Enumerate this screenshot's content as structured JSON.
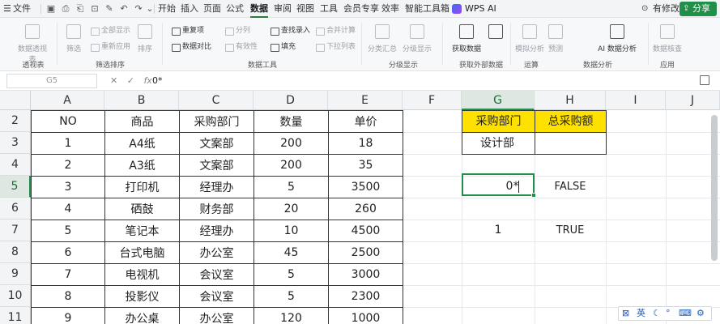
{
  "menubar": {
    "file_menu": "文件",
    "tabs": [
      "开始",
      "插入",
      "页面",
      "公式",
      "数据",
      "审阅",
      "视图",
      "工具",
      "会员专享",
      "效率",
      "智能工具箱"
    ],
    "active_tab": "数据",
    "wps_ai": "WPS AI",
    "review_label": "有修改",
    "share_label": "分享"
  },
  "ribbon": {
    "pivot_table": "数据透视表",
    "filter": "筛选",
    "show_all": "全部显示",
    "reapply": "重新应用",
    "sort": "排序",
    "duplicates": "重复项",
    "compare": "数据对比",
    "split": "分列",
    "validity": "有效性",
    "lookup_entry": "查找录入",
    "fill": "填充",
    "consolidate": "合并计算",
    "dropdown_list": "下拉列表",
    "subtotal": "分类汇总",
    "group_show": "分级显示",
    "get_data": "获取数据",
    "simulate": "模拟分析",
    "forecast": "预测",
    "group_label": "数据分析",
    "ai_data_analysis": "AI 数据分析",
    "data_check": "数据核查",
    "groups": {
      "pivot": "透视表",
      "filter_sort": "筛选排序",
      "data_tools": "数据工具",
      "outline": "分级显示",
      "external": "获取外部数据",
      "calc": "运算",
      "analysis": "数据分析",
      "apply": "应用"
    }
  },
  "formula_bar": {
    "name_box": "G5",
    "cancel_icon": "✕",
    "confirm_icon": "✓",
    "fx_label": "fx",
    "content": "0*"
  },
  "sheet": {
    "columns": [
      "A",
      "B",
      "C",
      "D",
      "E",
      "F",
      "G",
      "H",
      "I",
      "J"
    ],
    "rows": [
      "2",
      "3",
      "4",
      "5",
      "6",
      "7",
      "8",
      "9",
      "10",
      "11"
    ],
    "table_header": [
      "NO",
      "商品",
      "采购部门",
      "数量",
      "单价"
    ],
    "table_rows": [
      [
        "1",
        "A4纸",
        "文案部",
        "200",
        "18"
      ],
      [
        "2",
        "A3纸",
        "文案部",
        "200",
        "35"
      ],
      [
        "3",
        "打印机",
        "经理办",
        "5",
        "3500"
      ],
      [
        "4",
        "硒鼓",
        "财务部",
        "20",
        "260"
      ],
      [
        "5",
        "笔记本",
        "经理办",
        "10",
        "4500"
      ],
      [
        "6",
        "台式电脑",
        "办公室",
        "45",
        "2500"
      ],
      [
        "7",
        "电视机",
        "会议室",
        "5",
        "3000"
      ],
      [
        "8",
        "投影仪",
        "会议室",
        "5",
        "2300"
      ],
      [
        "9",
        "办公桌",
        "办公室",
        "120",
        "1000"
      ]
    ],
    "criteria_header": [
      "采购部门",
      "总采购额"
    ],
    "criteria_value": "设计部",
    "g5_edit": "0*",
    "h5_value": "FALSE",
    "g7_value": "1",
    "h7_value": "TRUE"
  },
  "ime_bar": {
    "lang": "英",
    "icons": [
      "ime-logo-icon",
      "moon-icon",
      "punctuation-icon",
      "keyboard-icon",
      "settings-icon"
    ]
  }
}
